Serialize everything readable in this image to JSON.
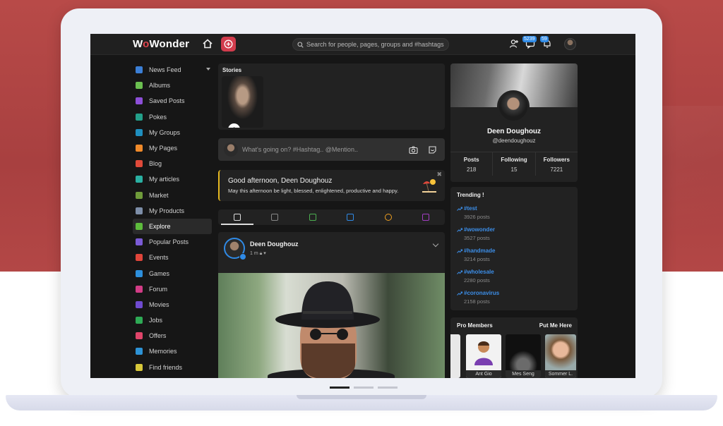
{
  "colors": {
    "accent": "#d23c4d",
    "link": "#3c8ee8",
    "bg": "#161616",
    "card": "#222222",
    "highlight": "#e5b820"
  },
  "header": {
    "logo": "WoWonder",
    "search_placeholder": "Search for people, pages, groups and #hashtags",
    "messages_badge": "5239",
    "notifications_badge": "59",
    "icons": [
      "home-icon",
      "add-icon",
      "search-icon",
      "user-plus-icon",
      "messages-icon",
      "bell-icon"
    ]
  },
  "sidebar": {
    "items": [
      {
        "label": "News Feed",
        "icon": "home-icon",
        "color": "#3b7fd6"
      },
      {
        "label": "Albums",
        "icon": "album-icon",
        "color": "#6bbf50"
      },
      {
        "label": "Saved Posts",
        "icon": "bookmark-icon",
        "color": "#8d4fd8"
      },
      {
        "label": "Pokes",
        "icon": "poke-icon",
        "color": "#23a08a"
      },
      {
        "label": "My Groups",
        "icon": "groups-icon",
        "color": "#1f8fbf"
      },
      {
        "label": "My Pages",
        "icon": "flag-icon",
        "color": "#f08a2a"
      },
      {
        "label": "Blog",
        "icon": "blog-icon",
        "color": "#e04a3a"
      },
      {
        "label": "My articles",
        "icon": "article-icon",
        "color": "#2ab0a2"
      },
      {
        "label": "Market",
        "icon": "market-icon",
        "color": "#6f9b3a"
      },
      {
        "label": "My Products",
        "icon": "products-icon",
        "color": "#7d8ea8"
      },
      {
        "label": "Explore",
        "icon": "explore-icon",
        "color": "#5dbb3c"
      },
      {
        "label": "Popular Posts",
        "icon": "popular-icon",
        "color": "#7b5bd6"
      },
      {
        "label": "Events",
        "icon": "calendar-icon",
        "color": "#e0453a"
      },
      {
        "label": "Games",
        "icon": "gamepad-icon",
        "color": "#2d8fdc"
      },
      {
        "label": "Forum",
        "icon": "forum-icon",
        "color": "#d23c86"
      },
      {
        "label": "Movies",
        "icon": "movies-icon",
        "color": "#6f4bd0"
      },
      {
        "label": "Jobs",
        "icon": "jobs-icon",
        "color": "#2eaa55"
      },
      {
        "label": "Offers",
        "icon": "offers-icon",
        "color": "#e0456a"
      },
      {
        "label": "Memories",
        "icon": "memories-icon",
        "color": "#2d93d6"
      },
      {
        "label": "Find friends",
        "icon": "find-friends-icon",
        "color": "#d8c83a"
      }
    ]
  },
  "stories": {
    "title": "Stories"
  },
  "composer": {
    "placeholder": "What's going on? #Hashtag.. @Mention.."
  },
  "greeting": {
    "title": "Good afternoon, Deen Doughouz",
    "message": "May this afternoon be light, blessed, enlightened, productive and happy."
  },
  "post": {
    "author": "Deen Doughouz",
    "time": "1 m"
  },
  "profile": {
    "name": "Deen Doughouz",
    "username": "@deendoughouz",
    "stats": [
      {
        "label": "Posts",
        "value": "218"
      },
      {
        "label": "Following",
        "value": "15"
      },
      {
        "label": "Followers",
        "value": "7221"
      }
    ]
  },
  "trending": {
    "title": "Trending !",
    "items": [
      {
        "tag": "#test",
        "count": "3926 posts"
      },
      {
        "tag": "#wowonder",
        "count": "3527 posts"
      },
      {
        "tag": "#handmade",
        "count": "3214 posts"
      },
      {
        "tag": "#wholesale",
        "count": "2280 posts"
      },
      {
        "tag": "#coronavirus",
        "count": "2158 posts"
      }
    ]
  },
  "pro_members": {
    "title": "Pro Members",
    "action": "Put Me Here",
    "members": [
      "Ant Gio",
      "Mes Seng",
      "Sommer L."
    ]
  }
}
